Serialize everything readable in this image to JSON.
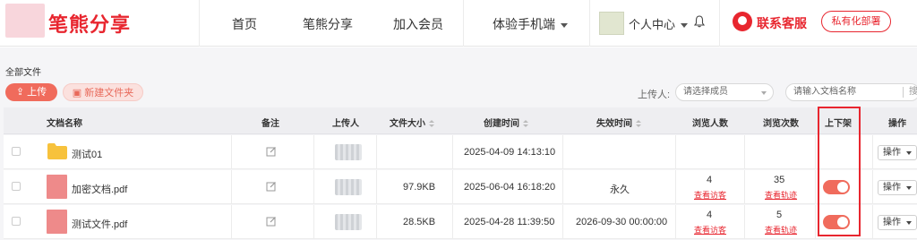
{
  "logo": {
    "text": "笔熊分享"
  },
  "nav": {
    "items": [
      "首页",
      "笔熊分享",
      "加入会员"
    ],
    "mobile": "体验手机端",
    "user_center": "个人中心",
    "customer_service": "联系客服",
    "private_deploy": "私有化部署"
  },
  "toolbar": {
    "breadcrumb": "全部文件",
    "upload_label": "上传",
    "new_folder_label": "新建文件夹",
    "uploader_label": "上传人:",
    "uploader_placeholder": "请选择成员",
    "search_placeholder": "请输入文档名称",
    "search_edge": "搜"
  },
  "table": {
    "headers": {
      "name": "文档名称",
      "note": "备注",
      "uploader": "上传人",
      "size": "文件大小",
      "created": "创建时间",
      "expires": "失效时间",
      "viewers": "浏览人数",
      "views": "浏览次数",
      "publish": "上下架",
      "actions": "操作"
    },
    "rows": [
      {
        "name": "测试01",
        "type": "folder",
        "size": "",
        "created": "2025-04-09 14:13:10",
        "expires": "",
        "viewers": "",
        "viewers_link": "",
        "views": "",
        "views_link": "",
        "published": null,
        "action": "操作"
      },
      {
        "name": "加密文档.pdf",
        "type": "pdf",
        "size": "97.9KB",
        "created": "2025-06-04 16:18:20",
        "expires": "永久",
        "viewers": "4",
        "viewers_link": "查看访客",
        "views": "35",
        "views_link": "查看轨迹",
        "published": true,
        "action": "操作"
      },
      {
        "name": "测试文件.pdf",
        "type": "pdf",
        "size": "28.5KB",
        "created": "2025-04-28 11:39:50",
        "expires": "2026-09-30 00:00:00",
        "viewers": "4",
        "viewers_link": "查看访客",
        "views": "5",
        "views_link": "查看轨迹",
        "published": true,
        "action": "操作"
      }
    ]
  },
  "colors": {
    "brand_red": "#e8262f",
    "accent_coral": "#f06b5c",
    "folder_yellow": "#f7c23c",
    "pdf_pink": "#ee8a8a"
  }
}
